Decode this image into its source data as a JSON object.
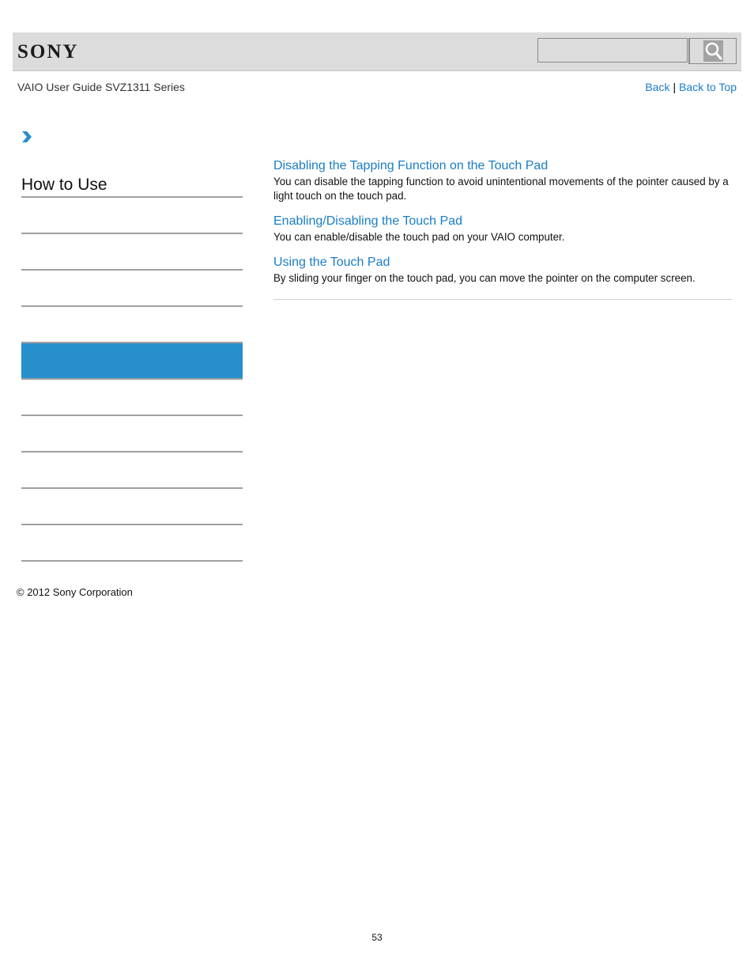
{
  "header": {
    "logo_text": "SONY",
    "search": {
      "placeholder": "",
      "value": "",
      "button_icon": "search-icon"
    }
  },
  "subheader": {
    "guide_title": "VAIO User Guide SVZ1311 Series",
    "back_label": "Back",
    "separator": "|",
    "back_to_top_label": "Back to Top"
  },
  "breadcrumb": {
    "icon": "chevron-right-icon",
    "accent_color": "#288fcd"
  },
  "sidebar": {
    "heading": "How to Use",
    "items": [
      {
        "label": "",
        "active": false
      },
      {
        "label": "",
        "active": false
      },
      {
        "label": "",
        "active": false
      },
      {
        "label": "",
        "active": false
      },
      {
        "label": "",
        "active": true
      },
      {
        "label": "",
        "active": false
      },
      {
        "label": "",
        "active": false
      },
      {
        "label": "",
        "active": false
      },
      {
        "label": "",
        "active": false
      },
      {
        "label": "",
        "active": false
      }
    ],
    "active_color": "#288fcd"
  },
  "main": {
    "topics": [
      {
        "title": "Disabling the Tapping Function on the Touch Pad",
        "description": "You can disable the tapping function to avoid unintentional movements of the pointer caused by a light touch on the touch pad."
      },
      {
        "title": "Enabling/Disabling the Touch Pad",
        "description": "You can enable/disable the touch pad on your VAIO computer."
      },
      {
        "title": "Using the Touch Pad",
        "description": "By sliding your finger on the touch pad, you can move the pointer on the computer screen."
      }
    ],
    "link_color": "#1a7dc5"
  },
  "footer": {
    "copyright": "© 2012 Sony Corporation",
    "page_number": "53"
  }
}
